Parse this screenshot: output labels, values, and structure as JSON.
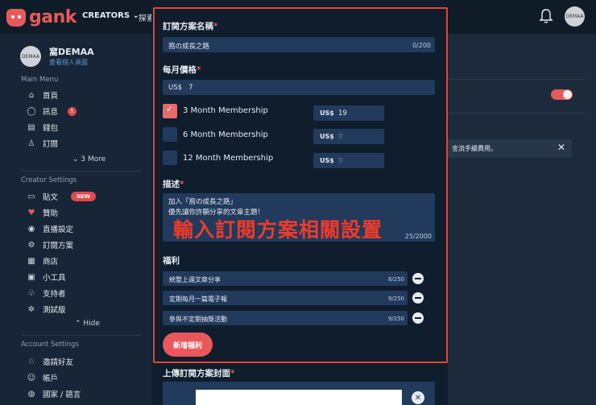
{
  "topbar": {
    "logo_text": "gank",
    "nav_creators": "CREATORS",
    "nav_explore": "探索",
    "avatar_text": "DEMAA"
  },
  "sidebar": {
    "avatar_text": "DEMAA",
    "user_name": "窩DEMAA",
    "profile_link": "查看個人頁面",
    "main_menu_title": "Main Menu",
    "main_items": [
      {
        "icon": "home-icon",
        "label": "首頁"
      },
      {
        "icon": "chat-icon",
        "label": "訊息",
        "badge": "1"
      },
      {
        "icon": "wallet-icon",
        "label": "錢包"
      },
      {
        "icon": "user-icon",
        "label": "訂閱"
      }
    ],
    "more_label": "3 More",
    "creator_settings_title": "Creator Settings",
    "creator_items": [
      {
        "icon": "post-icon",
        "label": "貼文",
        "badge": "NEW"
      },
      {
        "icon": "heart-icon",
        "label": "贊助"
      },
      {
        "icon": "broadcast-icon",
        "label": "直播設定"
      },
      {
        "icon": "gear-icon",
        "label": "訂閱方案"
      },
      {
        "icon": "store-icon",
        "label": "商店"
      },
      {
        "icon": "widgets-icon",
        "label": "小工具"
      },
      {
        "icon": "supporters-icon",
        "label": "支持者"
      },
      {
        "icon": "beta-icon",
        "label": "測試版"
      }
    ],
    "hide_label": "Hide",
    "account_settings_title": "Account Settings",
    "account_items": [
      {
        "icon": "invite-icon",
        "label": "邀請好友"
      },
      {
        "icon": "account-icon",
        "label": "帳戶"
      },
      {
        "icon": "globe-icon",
        "label": "國家 / 語言"
      }
    ]
  },
  "background": {
    "notice_text": "金流手續費用。",
    "notice_close": "✕",
    "toggle_on": true
  },
  "modal": {
    "plan_name_label": "訂閱方案名稱",
    "required_mark": "*",
    "plan_name_value": "窩の成長之路",
    "plan_name_count": "0/200",
    "monthly_price_label": "每月價格",
    "monthly_price_value": "US$   7",
    "memberships": [
      {
        "label": "3 Month Membership",
        "checked": true,
        "currency": "US$",
        "price": "19"
      },
      {
        "label": "6 Month Membership",
        "checked": false,
        "currency": "US$",
        "price": "0"
      },
      {
        "label": "12 Month Membership",
        "checked": false,
        "currency": "US$",
        "price": "0"
      }
    ],
    "description_label": "描述",
    "description_line1": "加入「窩の成長之路」",
    "description_line2": "優先讓你許願分享的文章主題！",
    "description_count": "25/2000",
    "annotation_caption": "輸入訂閱方案相關設置",
    "benefits_label": "福利",
    "benefits": [
      {
        "text": "統整上週文章分享",
        "count": "8/250"
      },
      {
        "text": "定期每月一篇電子報",
        "count": "9/250"
      },
      {
        "text": "參與不定期抽獎活動",
        "count": "9/250"
      }
    ],
    "add_benefit_button": "新增福利",
    "upload_cover_label": "上傳訂閱方案封面",
    "upload_close": "✕"
  },
  "colors": {
    "accent": "#e9575a",
    "annotation_red": "#ee3b2b",
    "modal_bg": "#0f1d2d",
    "input_bg": "#223a5c"
  }
}
